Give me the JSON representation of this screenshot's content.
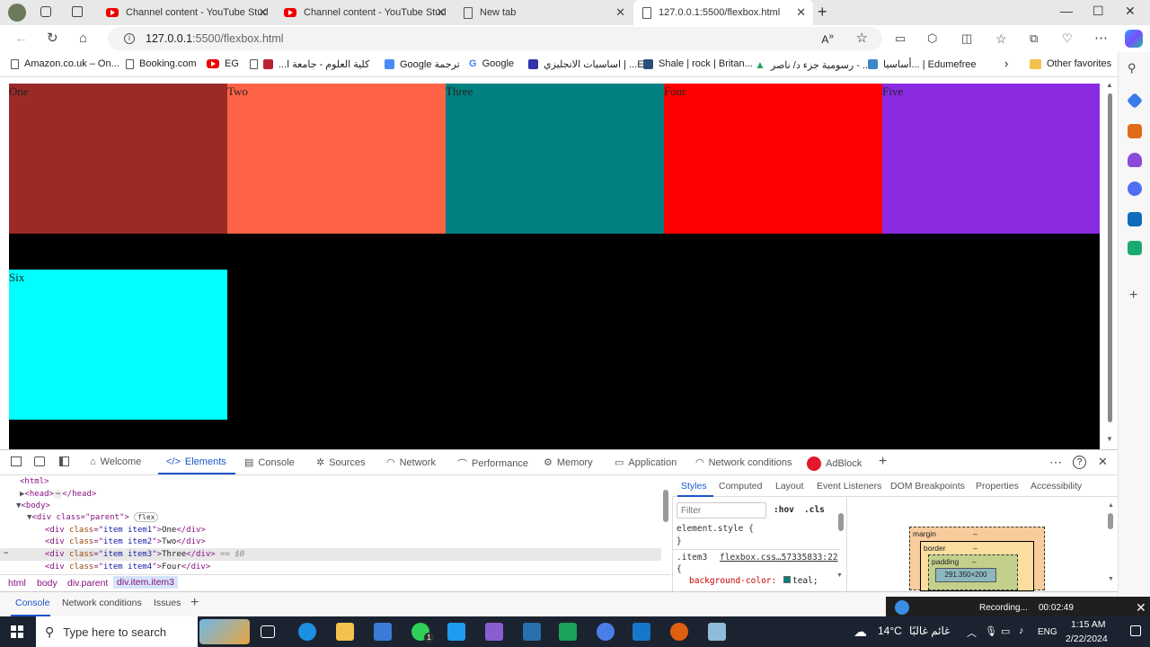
{
  "browser": {
    "tabs": [
      {
        "title": "Channel content - YouTube Stud",
        "icon": "youtube-icon"
      },
      {
        "title": "Channel content - YouTube Stud",
        "icon": "youtube-icon"
      },
      {
        "title": "New tab",
        "icon": "page-icon"
      },
      {
        "title": "127.0.0.1:5500/flexbox.html",
        "icon": "page-icon",
        "active": true
      }
    ],
    "address": {
      "host": "127.0.0.1",
      "path": ":5500/flexbox.html"
    },
    "favorites": [
      "Amazon.co.uk – On...",
      "Booking.com",
      "EG",
      "كلية العلوم - جامعة ا...",
      "Google ترجمة",
      "Google",
      "اساسيات الانجليزي | ...E",
      "Shale | rock | Britan...",
      "رسومية جزء د/ ناصر - ...",
      "أساسيا... | Edumefree"
    ],
    "other_favorites": "Other favorites"
  },
  "page": {
    "items": [
      {
        "label": "One",
        "color": "#9b2a27"
      },
      {
        "label": "Two",
        "color": "#ff6347"
      },
      {
        "label": "Three",
        "color": "#008080"
      },
      {
        "label": "Four",
        "color": "#ff0000"
      },
      {
        "label": "Five",
        "color": "#8a2be2"
      },
      {
        "label": "Six",
        "color": "#00ffff"
      }
    ],
    "parent_background": "#000000"
  },
  "devtools": {
    "tabs": [
      "Welcome",
      "Elements",
      "Console",
      "Sources",
      "Network",
      "Performance",
      "Memory",
      "Application",
      "Network conditions",
      "AdBlock"
    ],
    "active_tab": "Elements",
    "dom": {
      "html": "<html>",
      "head": "<head>",
      "head_end": "</head>",
      "body": "<body>",
      "parent_open": "<div class=\"parent\">",
      "flex_badge": "flex",
      "rows": [
        {
          "cls": "item item1",
          "text": "One"
        },
        {
          "cls": "item item2",
          "text": "Two"
        },
        {
          "cls": "item item3",
          "text": "Three"
        },
        {
          "cls": "item item4",
          "text": "Four"
        }
      ],
      "selected_marker": "== $0"
    },
    "breadcrumbs": [
      "html",
      "body",
      "div.parent",
      "div.item.item3"
    ],
    "styles_tabs": [
      "Styles",
      "Computed",
      "Layout",
      "Event Listeners",
      "DOM Breakpoints",
      "Properties",
      "Accessibility"
    ],
    "filter_placeholder": "Filter",
    "hov": ":hov",
    "cls": ".cls",
    "element_style": "element.style {",
    "close_brace": "}",
    "rule_selector": ".item3",
    "rule_source": "flexbox.css…57335833:22",
    "open_brace": "{",
    "declaration_prop": "background-color:",
    "declaration_value": "teal;",
    "box_model": {
      "margin": "margin",
      "border": "border",
      "padding": "padding",
      "dash": "–",
      "content": "291.350×200"
    },
    "drawer_tabs": [
      "Console",
      "Network conditions",
      "Issues"
    ]
  },
  "recording": {
    "label": "Recording...",
    "time": "00:02:49"
  },
  "taskbar": {
    "search_placeholder": "Type here to search",
    "weather_temp": "14°C",
    "weather_text": "غائم غالبًا",
    "lang": "ENG",
    "time": "1:15 AM",
    "date": "2/22/2024",
    "badge": "1"
  }
}
